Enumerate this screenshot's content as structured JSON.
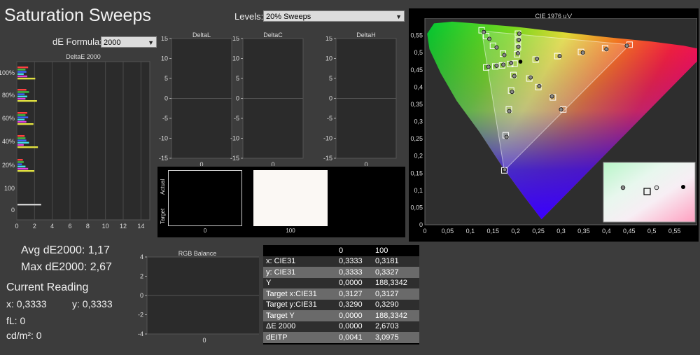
{
  "title": "Saturation Sweeps",
  "levels": {
    "label": "Levels:",
    "value": "20% Sweeps"
  },
  "de_formula": {
    "label": "dE Formula:",
    "value": "2000"
  },
  "summary": {
    "avg_label": "Avg dE2000: 1,17",
    "max_label": "Max dE2000: 2,67",
    "current_reading": "Current Reading",
    "x": "x: 0,3333",
    "y": "y: 0,3333",
    "fl": "fL: 0",
    "cdm2": "cd/m²: 0"
  },
  "swatches": {
    "actual_label": "Actual",
    "target_label": "Target",
    "labels": [
      "0",
      "100"
    ]
  },
  "table": {
    "headers": [
      "",
      "0",
      "100"
    ],
    "rows": [
      [
        "x: CIE31",
        "0,3333",
        "0,3181"
      ],
      [
        "y: CIE31",
        "0,3333",
        "0,3327"
      ],
      [
        "Y",
        "0,0000",
        "188,3342"
      ],
      [
        "Target x:CIE31",
        "0,3127",
        "0,3127"
      ],
      [
        "Target y:CIE31",
        "0,3290",
        "0,3290"
      ],
      [
        "Target Y",
        "0,0000",
        "188,3342"
      ],
      [
        "ΔE 2000",
        "0,0000",
        "2,6703"
      ],
      [
        "dEITP",
        "0,0041",
        "3,0975"
      ]
    ]
  },
  "chart_data": [
    {
      "type": "bar",
      "title": "DeltaE 2000",
      "orientation": "horizontal",
      "categories": [
        "100%",
        "80%",
        "60%",
        "40%",
        "20%",
        "100",
        "0"
      ],
      "xlim": [
        0,
        15
      ],
      "xticks": [
        "0",
        "2",
        "4",
        "6",
        "8",
        "10",
        "12",
        "14"
      ],
      "series": [
        {
          "values": [
            1.2,
            1.0,
            1.1,
            0.8,
            0.6,
            0,
            2.67
          ]
        },
        {
          "values": [
            0.9,
            1.3,
            0.9,
            0.9,
            0.7,
            0,
            0
          ]
        },
        {
          "values": [
            1.0,
            0.8,
            1.2,
            1.0,
            0.5,
            0,
            0
          ]
        },
        {
          "values": [
            0.7,
            1.1,
            0.8,
            1.3,
            0.9,
            0,
            0
          ]
        },
        {
          "values": [
            1.1,
            0.9,
            1.0,
            0.7,
            1.2,
            0,
            0
          ]
        },
        {
          "values": [
            2.0,
            2.2,
            1.8,
            2.3,
            1.9,
            0,
            0
          ]
        }
      ],
      "colors": [
        "#ff4040",
        "#40c040",
        "#4060ff",
        "#40e0e0",
        "#e040e0",
        "#e0e040",
        "#d0d0d0"
      ]
    },
    {
      "type": "bar",
      "title": "DeltaL",
      "categories": [
        "0"
      ],
      "values": [
        0
      ],
      "ylim": [
        -15,
        15
      ],
      "yticks": [
        "15",
        "10",
        "5",
        "0",
        "-5",
        "-10",
        "-15"
      ]
    },
    {
      "type": "bar",
      "title": "DeltaC",
      "categories": [
        "0"
      ],
      "values": [
        0
      ],
      "ylim": [
        -15,
        15
      ],
      "yticks": [
        "15",
        "10",
        "5",
        "0",
        "-5",
        "-10",
        "-15"
      ]
    },
    {
      "type": "bar",
      "title": "DeltaH",
      "categories": [
        "0"
      ],
      "values": [
        0
      ],
      "ylim": [
        -15,
        15
      ],
      "yticks": [
        "15",
        "10",
        "5",
        "0",
        "-5",
        "-10",
        "-15"
      ]
    },
    {
      "type": "bar",
      "title": "RGB Balance",
      "categories": [
        "0"
      ],
      "values": [
        0
      ],
      "ylim": [
        -4,
        4
      ],
      "yticks": [
        "4",
        "2",
        "0",
        "-2",
        "-4"
      ]
    },
    {
      "type": "scatter",
      "title": "CIE 1976 u'v'",
      "xlim": [
        0,
        0.6
      ],
      "ylim": [
        0,
        0.6
      ],
      "xticks": [
        "0",
        "0,05",
        "0,1",
        "0,15",
        "0,2",
        "0,25",
        "0,3",
        "0,35",
        "0,4",
        "0,45",
        "0,5",
        "0,55"
      ],
      "yticks": [
        "0,55",
        "0,5",
        "0,45",
        "0,4",
        "0,35",
        "0,3",
        "0,25",
        "0,2",
        "0,15",
        "0,1",
        "0,05",
        "0"
      ],
      "targets": [
        {
          "u": 0.125,
          "v": 0.565
        },
        {
          "u": 0.135,
          "v": 0.548
        },
        {
          "u": 0.15,
          "v": 0.52
        },
        {
          "u": 0.172,
          "v": 0.497
        },
        {
          "u": 0.451,
          "v": 0.523
        },
        {
          "u": 0.397,
          "v": 0.513
        },
        {
          "u": 0.344,
          "v": 0.502
        },
        {
          "u": 0.292,
          "v": 0.49
        },
        {
          "u": 0.244,
          "v": 0.48
        },
        {
          "u": 0.175,
          "v": 0.158
        },
        {
          "u": 0.178,
          "v": 0.26
        },
        {
          "u": 0.185,
          "v": 0.335
        },
        {
          "u": 0.19,
          "v": 0.39
        },
        {
          "u": 0.195,
          "v": 0.435
        },
        {
          "u": 0.205,
          "v": 0.555
        },
        {
          "u": 0.205,
          "v": 0.535
        },
        {
          "u": 0.205,
          "v": 0.515
        },
        {
          "u": 0.203,
          "v": 0.495
        },
        {
          "u": 0.305,
          "v": 0.335
        },
        {
          "u": 0.282,
          "v": 0.37
        },
        {
          "u": 0.25,
          "v": 0.4
        },
        {
          "u": 0.23,
          "v": 0.425
        },
        {
          "u": 0.135,
          "v": 0.457
        },
        {
          "u": 0.155,
          "v": 0.46
        },
        {
          "u": 0.17,
          "v": 0.463
        },
        {
          "u": 0.188,
          "v": 0.467
        },
        {
          "u": 0.1978,
          "v": 0.4683
        }
      ],
      "measured": [
        {
          "u": 0.13,
          "v": 0.56
        },
        {
          "u": 0.142,
          "v": 0.54
        },
        {
          "u": 0.158,
          "v": 0.515
        },
        {
          "u": 0.175,
          "v": 0.493
        },
        {
          "u": 0.445,
          "v": 0.52
        },
        {
          "u": 0.4,
          "v": 0.51
        },
        {
          "u": 0.348,
          "v": 0.5
        },
        {
          "u": 0.297,
          "v": 0.49
        },
        {
          "u": 0.247,
          "v": 0.482
        },
        {
          "u": 0.176,
          "v": 0.16
        },
        {
          "u": 0.18,
          "v": 0.255
        },
        {
          "u": 0.186,
          "v": 0.33
        },
        {
          "u": 0.192,
          "v": 0.386
        },
        {
          "u": 0.197,
          "v": 0.432
        },
        {
          "u": 0.208,
          "v": 0.555
        },
        {
          "u": 0.207,
          "v": 0.537
        },
        {
          "u": 0.206,
          "v": 0.517
        },
        {
          "u": 0.205,
          "v": 0.498
        },
        {
          "u": 0.3,
          "v": 0.335
        },
        {
          "u": 0.28,
          "v": 0.373
        },
        {
          "u": 0.252,
          "v": 0.403
        },
        {
          "u": 0.233,
          "v": 0.428
        },
        {
          "u": 0.14,
          "v": 0.459
        },
        {
          "u": 0.158,
          "v": 0.462
        },
        {
          "u": 0.173,
          "v": 0.465
        },
        {
          "u": 0.19,
          "v": 0.47
        }
      ],
      "current": {
        "u": 0.2105,
        "v": 0.4737
      }
    }
  ]
}
